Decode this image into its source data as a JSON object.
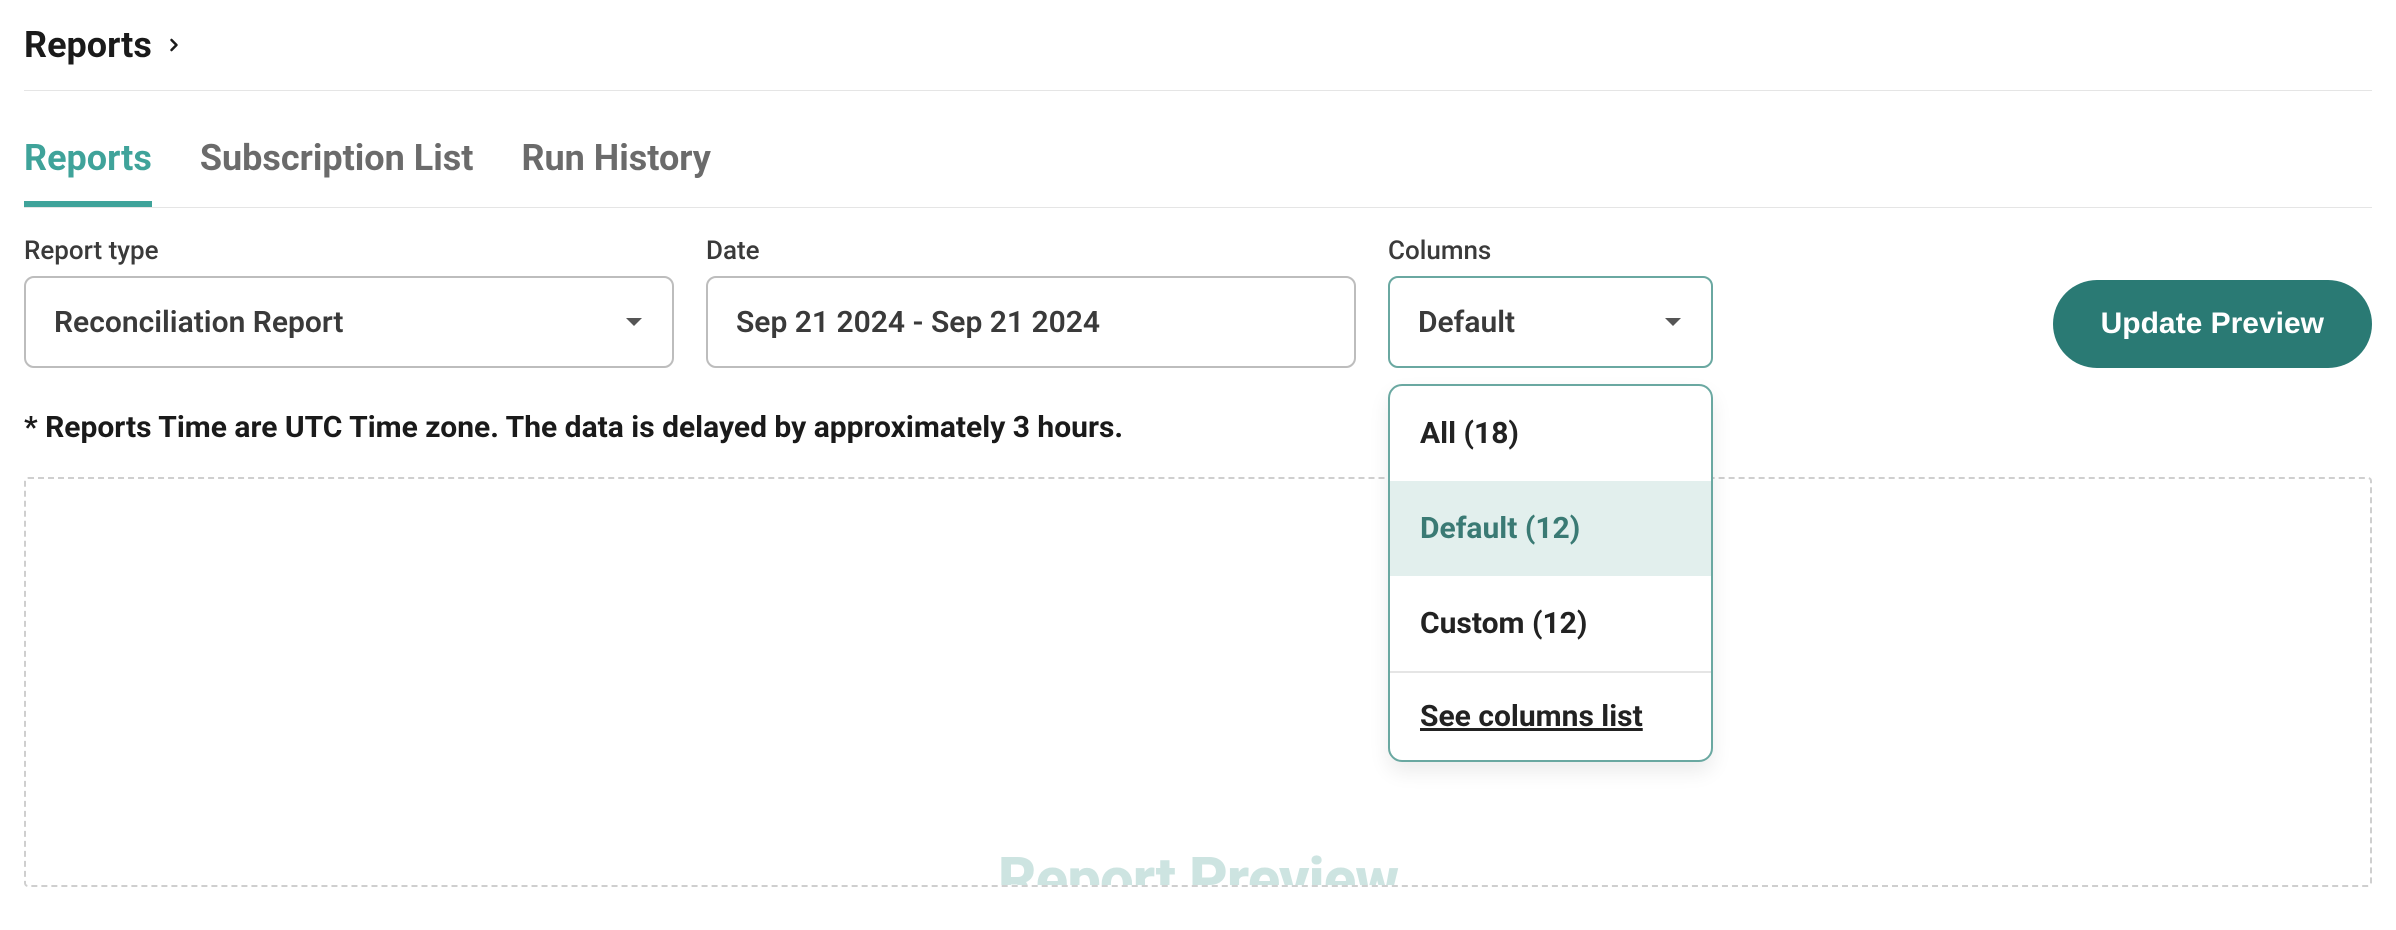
{
  "breadcrumb": {
    "title": "Reports"
  },
  "tabs": [
    {
      "label": "Reports",
      "active": true
    },
    {
      "label": "Subscription List",
      "active": false
    },
    {
      "label": "Run History",
      "active": false
    }
  ],
  "filters": {
    "report_type": {
      "label": "Report type",
      "value": "Reconciliation Report"
    },
    "date": {
      "label": "Date",
      "value": "Sep 21 2024 - Sep 21 2024"
    },
    "columns": {
      "label": "Columns",
      "value": "Default",
      "options": [
        {
          "label": "All (18)",
          "selected": false
        },
        {
          "label": "Default (12)",
          "selected": true
        },
        {
          "label": "Custom (12)",
          "selected": false
        }
      ],
      "footer_link": "See columns list"
    }
  },
  "actions": {
    "update_preview": "Update Preview"
  },
  "note": "* Reports Time are UTC Time zone. The data is delayed by approximately 3 hours.",
  "preview": {
    "watermark": "Report Preview"
  }
}
